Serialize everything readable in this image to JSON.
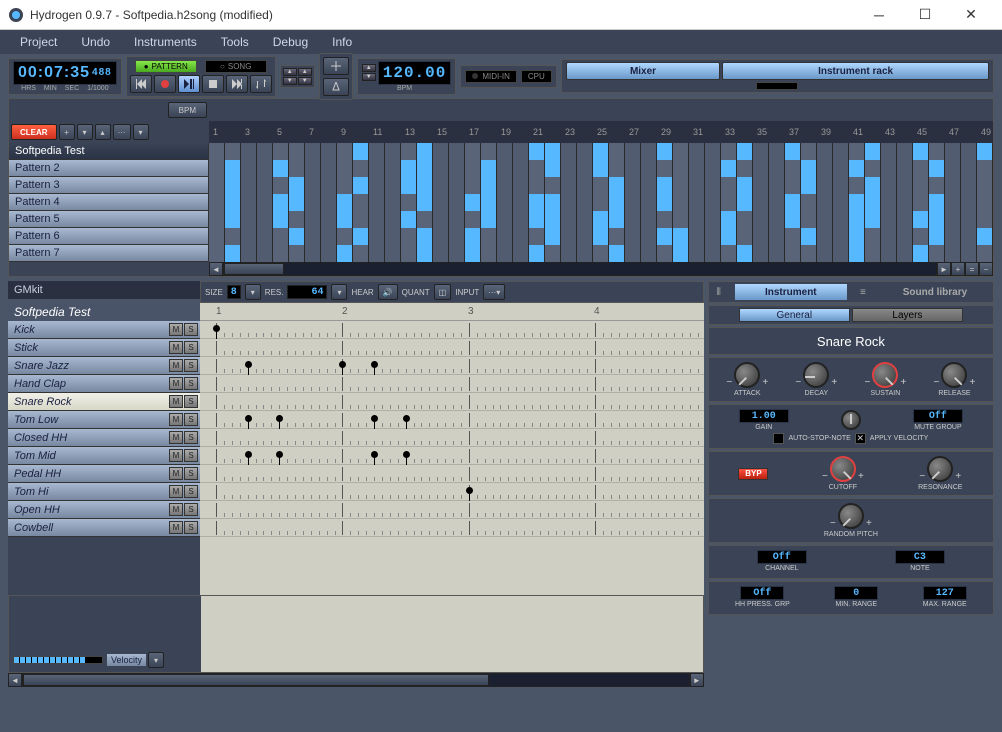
{
  "window": {
    "title": "Hydrogen 0.9.7 - Softpedia.h2song (modified)"
  },
  "menu": [
    "Project",
    "Undo",
    "Instruments",
    "Tools",
    "Debug",
    "Info"
  ],
  "time": {
    "display": "00:07:35",
    "ms": "488",
    "cols": [
      "HRS",
      "MIN",
      "SEC",
      "1/1000"
    ]
  },
  "mode": {
    "pattern": "PATTERN",
    "song": "SONG"
  },
  "bpm": {
    "value": "120.00",
    "label": "BPM"
  },
  "midi": {
    "label": "MIDI-IN",
    "cpu": "CPU"
  },
  "rack": {
    "mixer": "Mixer",
    "inst": "Instrument rack"
  },
  "song": {
    "bpm_btn": "BPM",
    "clear": "CLEAR",
    "patterns": [
      "Softpedia Test",
      "Pattern 2",
      "Pattern 3",
      "Pattern 4",
      "Pattern 5",
      "Pattern 6",
      "Pattern 7"
    ],
    "ticks": [
      "1",
      "3",
      "5",
      "7",
      "9",
      "11",
      "13",
      "15",
      "17",
      "19",
      "21",
      "23",
      "25",
      "27",
      "29",
      "31",
      "33",
      "35",
      "37",
      "39",
      "41",
      "43",
      "45",
      "47",
      "49"
    ],
    "cells": [
      [
        0,
        0,
        1,
        1,
        0,
        0,
        1,
        0,
        0,
        1,
        0,
        1,
        0,
        1,
        0,
        1,
        0,
        0,
        1,
        0,
        1,
        1,
        0,
        0,
        1,
        0,
        1,
        0,
        1,
        0,
        1,
        0,
        0,
        1,
        0,
        0,
        1,
        0,
        1,
        1,
        0,
        1,
        0,
        1,
        1,
        0,
        0,
        1,
        1
      ],
      [
        0,
        1,
        0,
        1,
        1,
        0,
        1,
        1,
        0,
        0,
        1,
        0,
        1,
        1,
        0,
        0,
        0,
        1,
        0,
        0,
        0,
        1,
        0,
        1,
        1,
        0,
        0,
        1,
        0,
        0,
        0,
        0,
        1,
        0,
        1,
        0,
        0,
        1,
        0,
        0,
        1,
        0,
        0,
        0,
        0,
        1,
        0,
        0,
        0
      ],
      [
        0,
        1,
        1,
        1,
        0,
        1,
        0,
        1,
        0,
        1,
        0,
        0,
        1,
        1,
        1,
        0,
        0,
        1,
        1,
        1,
        0,
        0,
        1,
        1,
        0,
        1,
        0,
        0,
        1,
        0,
        0,
        1,
        0,
        1,
        0,
        0,
        0,
        1,
        1,
        1,
        0,
        1,
        1,
        1,
        0,
        0,
        1,
        1,
        0
      ],
      [
        0,
        1,
        1,
        0,
        1,
        1,
        0,
        0,
        1,
        0,
        0,
        1,
        0,
        1,
        0,
        1,
        1,
        1,
        0,
        0,
        1,
        1,
        1,
        0,
        0,
        1,
        1,
        0,
        1,
        0,
        1,
        1,
        0,
        1,
        0,
        1,
        1,
        0,
        1,
        0,
        1,
        1,
        1,
        0,
        0,
        1,
        1,
        0,
        0
      ],
      [
        0,
        1,
        0,
        1,
        1,
        0,
        0,
        1,
        1,
        0,
        0,
        0,
        1,
        0,
        1,
        1,
        0,
        1,
        1,
        0,
        1,
        1,
        0,
        0,
        1,
        1,
        1,
        1,
        0,
        0,
        1,
        0,
        1,
        0,
        1,
        1,
        1,
        0,
        0,
        1,
        1,
        1,
        0,
        0,
        1,
        1,
        0,
        1,
        0
      ],
      [
        0,
        0,
        1,
        0,
        0,
        1,
        1,
        1,
        0,
        1,
        1,
        1,
        0,
        1,
        0,
        1,
        1,
        0,
        1,
        0,
        0,
        1,
        1,
        0,
        1,
        0,
        1,
        0,
        1,
        1,
        0,
        0,
        1,
        0,
        1,
        1,
        0,
        1,
        0,
        0,
        1,
        0,
        1,
        1,
        0,
        1,
        1,
        0,
        1
      ],
      [
        0,
        1,
        0,
        1,
        0,
        0,
        0,
        1,
        1,
        0,
        0,
        1,
        0,
        1,
        1,
        0,
        1,
        0,
        0,
        0,
        1,
        0,
        0,
        0,
        0,
        1,
        0,
        1,
        0,
        1,
        0,
        1,
        0,
        1,
        0,
        1,
        0,
        0,
        1,
        0,
        1,
        0,
        0,
        0,
        1,
        0,
        0,
        1,
        0
      ]
    ]
  },
  "kit_name": "GMkit",
  "pat": {
    "name": "Softpedia Test",
    "size_lbl": "SIZE",
    "size": "8",
    "res_lbl": "RES.",
    "res": "64",
    "hear_lbl": "HEAR",
    "quant_lbl": "QUANT",
    "input_lbl": "INPUT",
    "instruments": [
      "Kick",
      "Stick",
      "Snare Jazz",
      "Hand Clap",
      "Snare Rock",
      "Tom Low",
      "Closed HH",
      "Tom Mid",
      "Pedal HH",
      "Tom Hi",
      "Open HH",
      "Cowbell"
    ],
    "selected": 4,
    "beats": [
      "1",
      "2",
      "3",
      "4"
    ],
    "velocity": "Velocity"
  },
  "inst": {
    "tabs": {
      "inst": "Instrument",
      "lib": "Sound library"
    },
    "sub": {
      "gen": "General",
      "lay": "Layers"
    },
    "name": "Snare Rock",
    "adsr": {
      "a": "ATTACK",
      "d": "DECAY",
      "s": "SUSTAIN",
      "r": "RELEASE"
    },
    "gain": {
      "val": "1.00",
      "lbl": "GAIN"
    },
    "mute": {
      "val": "Off",
      "lbl": "MUTE GROUP"
    },
    "auto_stop": "AUTO-STOP-NOTE",
    "apply_vel": "APPLY VELOCITY",
    "byp": "BYP",
    "cutoff": "CUTOFF",
    "resonance": "RESONANCE",
    "random_pitch": "RANDOM PITCH",
    "channel": {
      "val": "Off",
      "lbl": "CHANNEL"
    },
    "note": {
      "val": "C3",
      "lbl": "NOTE"
    },
    "hh": {
      "val": "Off",
      "lbl": "HH PRESS. GRP"
    },
    "min": {
      "val": "0",
      "lbl": "MIN. RANGE"
    },
    "max": {
      "val": "127",
      "lbl": "MAX. RANGE"
    }
  }
}
